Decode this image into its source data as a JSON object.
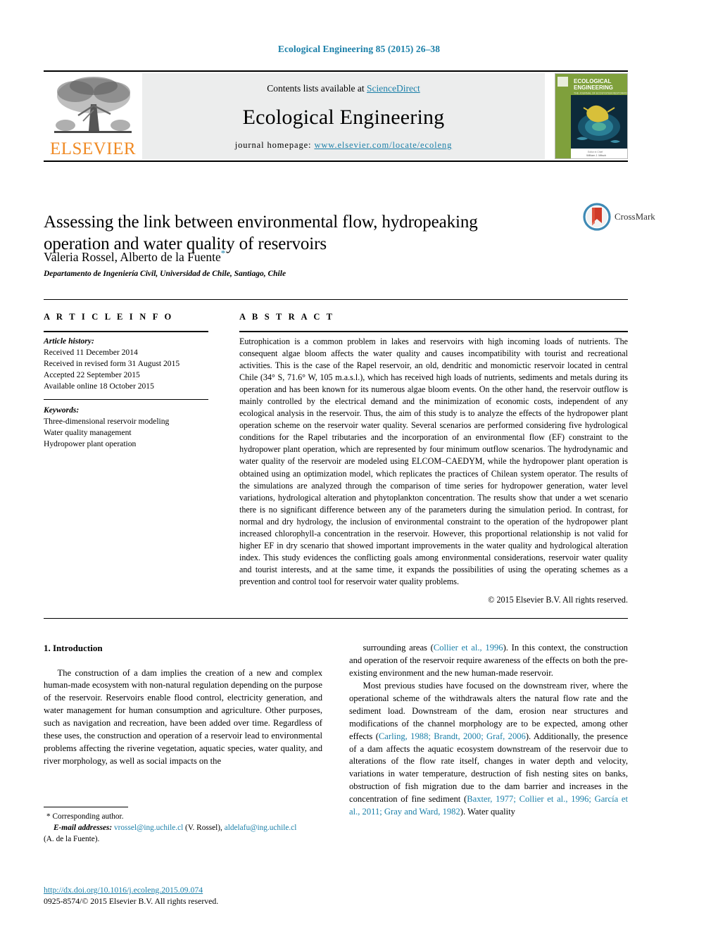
{
  "running_head": "Ecological Engineering 85 (2015) 26–38",
  "banner": {
    "publisher_logo_text": "ELSEVIER",
    "contents_prefix": "Contents lists available at ",
    "contents_link": "ScienceDirect",
    "journal_name": "Ecological Engineering",
    "homepage_prefix": "journal homepage: ",
    "homepage_url": "www.elsevier.com/locate/ecoleng",
    "cover": {
      "line1": "ECOLOGICAL",
      "line2": "ENGINEERING"
    }
  },
  "article": {
    "title": "Assessing the link between environmental flow, hydropeaking operation and water quality of reservoirs",
    "authors": "Valeria Rossel, Alberto de la Fuente",
    "corresponding_marker": "*",
    "affiliation": "Departamento de Ingeniería Civil, Universidad de Chile, Santiago, Chile",
    "crossmark_label": "CrossMark"
  },
  "article_info": {
    "heading": "A R T I C L E   I N F O",
    "history_label": "Article history:",
    "history": [
      "Received 11 December 2014",
      "Received in revised form 31 August 2015",
      "Accepted 22 September 2015",
      "Available online 18 October 2015"
    ],
    "keywords_label": "Keywords:",
    "keywords": [
      "Three-dimensional reservoir modeling",
      "Water quality management",
      "Hydropower plant operation"
    ]
  },
  "abstract": {
    "heading": "A B S T R A C T",
    "text": "Eutrophication is a common problem in lakes and reservoirs with high incoming loads of nutrients. The consequent algae bloom affects the water quality and causes incompatibility with tourist and recreational activities. This is the case of the Rapel reservoir, an old, dendritic and monomictic reservoir located in central Chile (34° S, 71.6° W, 105 m.a.s.l.), which has received high loads of nutrients, sediments and metals during its operation and has been known for its numerous algae bloom events. On the other hand, the reservoir outflow is mainly controlled by the electrical demand and the minimization of economic costs, independent of any ecological analysis in the reservoir. Thus, the aim of this study is to analyze the effects of the hydropower plant operation scheme on the reservoir water quality. Several scenarios are performed considering five hydrological conditions for the Rapel tributaries and the incorporation of an environmental flow (EF) constraint to the hydropower plant operation, which are represented by four minimum outflow scenarios. The hydrodynamic and water quality of the reservoir are modeled using ELCOM–CAEDYM, while the hydropower plant operation is obtained using an optimization model, which replicates the practices of Chilean system operator. The results of the simulations are analyzed through the comparison of time series for hydropower generation, water level variations, hydrological alteration and phytoplankton concentration. The results show that under a wet scenario there is no significant difference between any of the parameters during the simulation period. In contrast, for normal and dry hydrology, the inclusion of environmental constraint to the operation of the hydropower plant increased chlorophyll-a concentration in the reservoir. However, this proportional relationship is not valid for higher EF in dry scenario that showed important improvements in the water quality and hydrological alteration index. This study evidences the conflicting goals among environmental considerations, reservoir water quality and tourist interests, and at the same time, it expands the possibilities of using the operating schemes as a prevention and control tool for reservoir water quality problems.",
    "copyright": "© 2015 Elsevier B.V. All rights reserved."
  },
  "body": {
    "section_number_title": "1.  Introduction",
    "left_paragraph": "The construction of a dam implies the creation of a new and complex human-made ecosystem with non-natural regulation depending on the purpose of the reservoir. Reservoirs enable flood control, electricity generation, and water management for human consumption and agriculture. Other purposes, such as navigation and recreation, have been added over time. Regardless of these uses, the construction and operation of a reservoir lead to environmental problems affecting the riverine vegetation, aquatic species, water quality, and river morphology, as well as social impacts on the",
    "right_par1_a": "surrounding areas (",
    "right_par1_ref": "Collier et al., 1996",
    "right_par1_b": "). In this context, the construction and operation of the reservoir require awareness of the effects on both the pre-existing environment and the new human-made reservoir.",
    "right_par2_a": "Most previous studies have focused on the downstream river, where the operational scheme of the withdrawals alters the natural flow rate and the sediment load. Downstream of the dam, erosion near structures and modifications of the channel morphology are to be expected, among other effects (",
    "right_par2_ref1": "Carling, 1988; Brandt, 2000; Graf, 2006",
    "right_par2_b": "). Additionally, the presence of a dam affects the aquatic ecosystem downstream of the reservoir due to alterations of the flow rate itself, changes in water depth and velocity, variations in water temperature, destruction of fish nesting sites on banks, obstruction of fish migration due to the dam barrier and increases in the concentration of fine sediment (",
    "right_par2_ref2": "Baxter, 1977; Collier et al., 1996; García et al., 2011; Gray and Ward, 1982",
    "right_par2_c": "). Water quality"
  },
  "footnotes": {
    "corresponding_marker": "*",
    "corresponding_text": "Corresponding author.",
    "email_label": "E-mail addresses:",
    "email1": "vrossel@ing.uchile.cl",
    "email1_owner": " (V. Rossel), ",
    "email2": "aldelafu@ing.uchile.cl",
    "email2_owner": "(A. de la Fuente).",
    "doi": "http://dx.doi.org/10.1016/j.ecoleng.2015.09.074",
    "issn_line": "0925-8574/© 2015 Elsevier B.V. All rights reserved."
  },
  "colors": {
    "link": "#1a7fa8",
    "elsevier_orange": "#f08a24",
    "banner_bg": "#eceded"
  }
}
